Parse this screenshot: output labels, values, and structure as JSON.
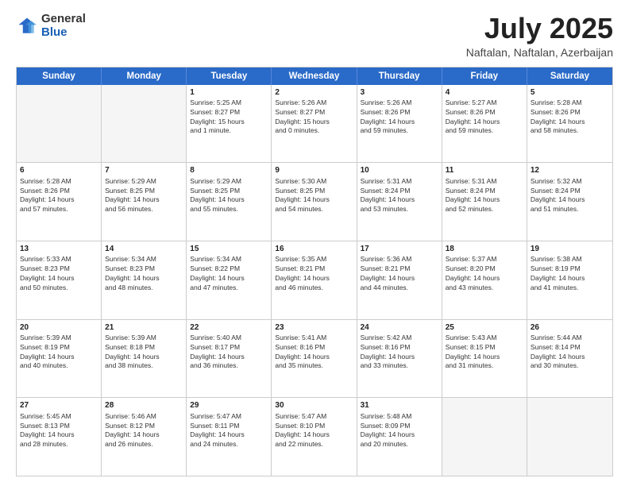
{
  "logo": {
    "general": "General",
    "blue": "Blue"
  },
  "title": {
    "month_year": "July 2025",
    "location": "Naftalan, Naftalan, Azerbaijan"
  },
  "header_days": [
    "Sunday",
    "Monday",
    "Tuesday",
    "Wednesday",
    "Thursday",
    "Friday",
    "Saturday"
  ],
  "weeks": [
    [
      {
        "day": "",
        "info": "",
        "empty": true
      },
      {
        "day": "",
        "info": "",
        "empty": true
      },
      {
        "day": "1",
        "info": "Sunrise: 5:25 AM\nSunset: 8:27 PM\nDaylight: 15 hours\nand 1 minute.",
        "empty": false
      },
      {
        "day": "2",
        "info": "Sunrise: 5:26 AM\nSunset: 8:27 PM\nDaylight: 15 hours\nand 0 minutes.",
        "empty": false
      },
      {
        "day": "3",
        "info": "Sunrise: 5:26 AM\nSunset: 8:26 PM\nDaylight: 14 hours\nand 59 minutes.",
        "empty": false
      },
      {
        "day": "4",
        "info": "Sunrise: 5:27 AM\nSunset: 8:26 PM\nDaylight: 14 hours\nand 59 minutes.",
        "empty": false
      },
      {
        "day": "5",
        "info": "Sunrise: 5:28 AM\nSunset: 8:26 PM\nDaylight: 14 hours\nand 58 minutes.",
        "empty": false
      }
    ],
    [
      {
        "day": "6",
        "info": "Sunrise: 5:28 AM\nSunset: 8:26 PM\nDaylight: 14 hours\nand 57 minutes.",
        "empty": false
      },
      {
        "day": "7",
        "info": "Sunrise: 5:29 AM\nSunset: 8:25 PM\nDaylight: 14 hours\nand 56 minutes.",
        "empty": false
      },
      {
        "day": "8",
        "info": "Sunrise: 5:29 AM\nSunset: 8:25 PM\nDaylight: 14 hours\nand 55 minutes.",
        "empty": false
      },
      {
        "day": "9",
        "info": "Sunrise: 5:30 AM\nSunset: 8:25 PM\nDaylight: 14 hours\nand 54 minutes.",
        "empty": false
      },
      {
        "day": "10",
        "info": "Sunrise: 5:31 AM\nSunset: 8:24 PM\nDaylight: 14 hours\nand 53 minutes.",
        "empty": false
      },
      {
        "day": "11",
        "info": "Sunrise: 5:31 AM\nSunset: 8:24 PM\nDaylight: 14 hours\nand 52 minutes.",
        "empty": false
      },
      {
        "day": "12",
        "info": "Sunrise: 5:32 AM\nSunset: 8:24 PM\nDaylight: 14 hours\nand 51 minutes.",
        "empty": false
      }
    ],
    [
      {
        "day": "13",
        "info": "Sunrise: 5:33 AM\nSunset: 8:23 PM\nDaylight: 14 hours\nand 50 minutes.",
        "empty": false
      },
      {
        "day": "14",
        "info": "Sunrise: 5:34 AM\nSunset: 8:23 PM\nDaylight: 14 hours\nand 48 minutes.",
        "empty": false
      },
      {
        "day": "15",
        "info": "Sunrise: 5:34 AM\nSunset: 8:22 PM\nDaylight: 14 hours\nand 47 minutes.",
        "empty": false
      },
      {
        "day": "16",
        "info": "Sunrise: 5:35 AM\nSunset: 8:21 PM\nDaylight: 14 hours\nand 46 minutes.",
        "empty": false
      },
      {
        "day": "17",
        "info": "Sunrise: 5:36 AM\nSunset: 8:21 PM\nDaylight: 14 hours\nand 44 minutes.",
        "empty": false
      },
      {
        "day": "18",
        "info": "Sunrise: 5:37 AM\nSunset: 8:20 PM\nDaylight: 14 hours\nand 43 minutes.",
        "empty": false
      },
      {
        "day": "19",
        "info": "Sunrise: 5:38 AM\nSunset: 8:19 PM\nDaylight: 14 hours\nand 41 minutes.",
        "empty": false
      }
    ],
    [
      {
        "day": "20",
        "info": "Sunrise: 5:39 AM\nSunset: 8:19 PM\nDaylight: 14 hours\nand 40 minutes.",
        "empty": false
      },
      {
        "day": "21",
        "info": "Sunrise: 5:39 AM\nSunset: 8:18 PM\nDaylight: 14 hours\nand 38 minutes.",
        "empty": false
      },
      {
        "day": "22",
        "info": "Sunrise: 5:40 AM\nSunset: 8:17 PM\nDaylight: 14 hours\nand 36 minutes.",
        "empty": false
      },
      {
        "day": "23",
        "info": "Sunrise: 5:41 AM\nSunset: 8:16 PM\nDaylight: 14 hours\nand 35 minutes.",
        "empty": false
      },
      {
        "day": "24",
        "info": "Sunrise: 5:42 AM\nSunset: 8:16 PM\nDaylight: 14 hours\nand 33 minutes.",
        "empty": false
      },
      {
        "day": "25",
        "info": "Sunrise: 5:43 AM\nSunset: 8:15 PM\nDaylight: 14 hours\nand 31 minutes.",
        "empty": false
      },
      {
        "day": "26",
        "info": "Sunrise: 5:44 AM\nSunset: 8:14 PM\nDaylight: 14 hours\nand 30 minutes.",
        "empty": false
      }
    ],
    [
      {
        "day": "27",
        "info": "Sunrise: 5:45 AM\nSunset: 8:13 PM\nDaylight: 14 hours\nand 28 minutes.",
        "empty": false
      },
      {
        "day": "28",
        "info": "Sunrise: 5:46 AM\nSunset: 8:12 PM\nDaylight: 14 hours\nand 26 minutes.",
        "empty": false
      },
      {
        "day": "29",
        "info": "Sunrise: 5:47 AM\nSunset: 8:11 PM\nDaylight: 14 hours\nand 24 minutes.",
        "empty": false
      },
      {
        "day": "30",
        "info": "Sunrise: 5:47 AM\nSunset: 8:10 PM\nDaylight: 14 hours\nand 22 minutes.",
        "empty": false
      },
      {
        "day": "31",
        "info": "Sunrise: 5:48 AM\nSunset: 8:09 PM\nDaylight: 14 hours\nand 20 minutes.",
        "empty": false
      },
      {
        "day": "",
        "info": "",
        "empty": true
      },
      {
        "day": "",
        "info": "",
        "empty": true
      }
    ]
  ]
}
